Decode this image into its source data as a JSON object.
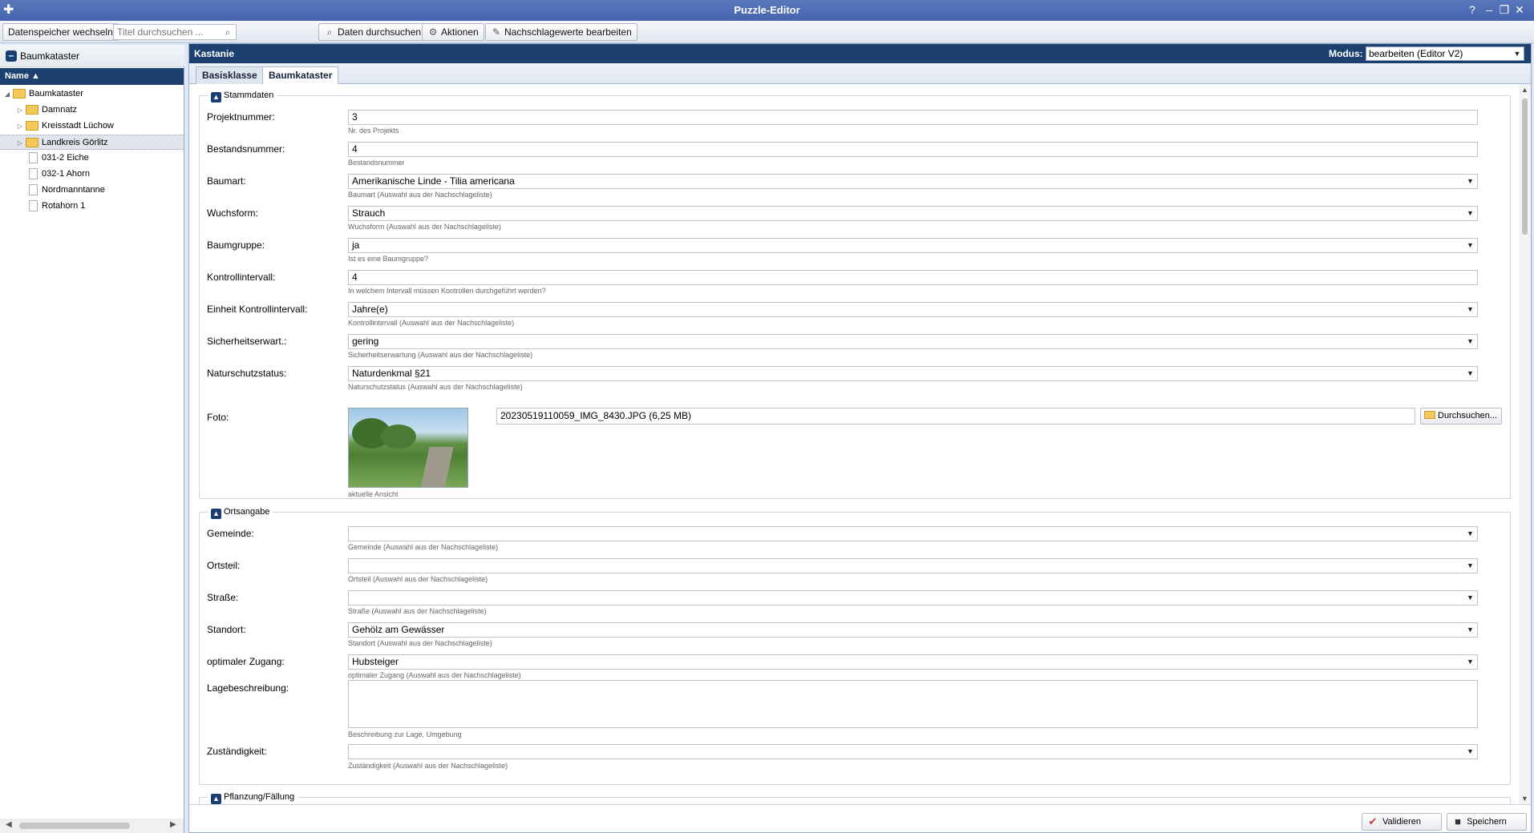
{
  "window": {
    "title": "Puzzle-Editor",
    "controls": [
      "?",
      "–",
      "❐",
      "✕"
    ]
  },
  "toolbar": {
    "switch_store": "Datenspeicher wechseln",
    "search_placeholder": "Titel durchsuchen ...",
    "search_data": "Daten durchsuchen",
    "actions": "Aktionen",
    "edit_lookup": "Nachschlagewerte bearbeiten"
  },
  "left": {
    "header": "Baumkataster",
    "column": "Name ▲",
    "tree": [
      {
        "label": "Baumkataster",
        "type": "folder",
        "level": 0,
        "expanded": true
      },
      {
        "label": "Damnatz",
        "type": "folder",
        "level": 1
      },
      {
        "label": "Kreisstadt Lüchow",
        "type": "folder",
        "level": 1
      },
      {
        "label": "Landkreis Görlitz",
        "type": "folder",
        "level": 1,
        "selected": true
      },
      {
        "label": "031-2 Eiche",
        "type": "doc",
        "level": 1
      },
      {
        "label": "032-1 Ahorn",
        "type": "doc",
        "level": 1
      },
      {
        "label": "Nordmanntanne",
        "type": "doc",
        "level": 1
      },
      {
        "label": "Rotahorn 1",
        "type": "doc",
        "level": 1
      }
    ]
  },
  "main": {
    "title": "Kastanie",
    "mode_label": "Modus:",
    "mode_value": "bearbeiten (Editor V2)",
    "tabs": [
      "Basisklasse",
      "Baumkataster"
    ],
    "active_tab": 1,
    "sections": {
      "stammdaten": {
        "title": "Stammdaten",
        "fields": [
          {
            "label": "Projektnummer:",
            "value": "3",
            "hint": "Nr. des Projekts",
            "dropdown": false
          },
          {
            "label": "Bestandsnummer:",
            "value": "4",
            "hint": "Bestandsnummer",
            "dropdown": false
          },
          {
            "label": "Baumart:",
            "value": "Amerikanische Linde -  Tilia americana",
            "hint": "Baumart (Auswahl aus der Nachschlageliste)",
            "dropdown": true
          },
          {
            "label": "Wuchsform:",
            "value": "Strauch",
            "hint": "Wuchsform (Auswahl aus der Nachschlageliste)",
            "dropdown": true
          },
          {
            "label": "Baumgruppe:",
            "value": "ja",
            "hint": "Ist es eine Baumgruppe?",
            "dropdown": true
          },
          {
            "label": "Kontrollintervall:",
            "value": "4",
            "hint": "In welchem Intervall müssen Kontrollen durchgeführt werden?",
            "dropdown": false
          },
          {
            "label": "Einheit Kontrollintervall:",
            "value": "Jahre(e)",
            "hint": "Kontrollintervall (Auswahl aus der Nachschlageliste)",
            "dropdown": true
          },
          {
            "label": "Sicherheitserwart.:",
            "value": "gering",
            "hint": "Sicherheitserwartung (Auswahl aus der Nachschlageliste)",
            "dropdown": true
          },
          {
            "label": "Naturschutzstatus:",
            "value": "Naturdenkmal §21",
            "hint": "Naturschutzstatus (Auswahl aus der Nachschlageliste)",
            "dropdown": true
          }
        ],
        "photo": {
          "label": "Foto:",
          "filename": "20230519110059_IMG_8430.JPG (6,25 MB)",
          "browse": "Durchsuchen...",
          "hint": "aktuelle Ansicht"
        }
      },
      "ortsangabe": {
        "title": "Ortsangabe",
        "fields": [
          {
            "label": "Gemeinde:",
            "value": "",
            "hint": "Gemeinde (Auswahl aus der Nachschlageliste)",
            "dropdown": true
          },
          {
            "label": "Ortsteil:",
            "value": "",
            "hint": "Ortsteil (Auswahl aus der Nachschlageliste)",
            "dropdown": true
          },
          {
            "label": "Straße:",
            "value": "",
            "hint": "Straße (Auswahl aus der Nachschlageliste)",
            "dropdown": true
          },
          {
            "label": "Standort:",
            "value": "Gehölz am Gewässer",
            "hint": "Standort (Auswahl aus der Nachschlageliste)",
            "dropdown": true
          },
          {
            "label": "optimaler Zugang:",
            "value": "Hubsteiger",
            "hint": "optimaler Zugang (Auswahl aus der Nachschlageliste)",
            "dropdown": true
          }
        ],
        "lage": {
          "label": "Lagebeschreibung:",
          "value": "",
          "hint": "Beschreibung zur Lage, Umgebung"
        },
        "zust": {
          "label": "Zuständigkeit:",
          "value": "",
          "hint": "Zuständigkeit (Auswahl aus der Nachschlageliste)"
        }
      },
      "pflanzung": {
        "title": "Pflanzung/Fällung"
      }
    },
    "footer": {
      "validate": "Validieren",
      "save": "Speichern"
    }
  }
}
